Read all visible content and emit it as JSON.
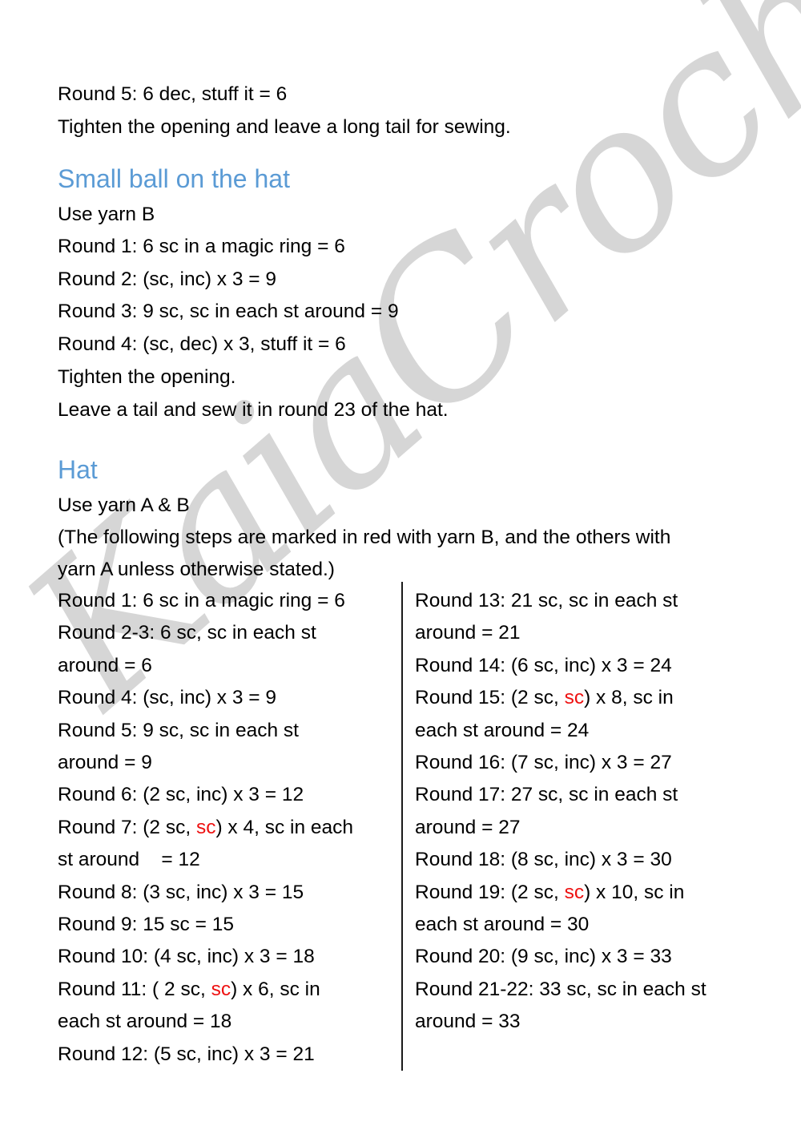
{
  "document": {
    "type": "crochet-pattern",
    "watermark_text": "KaiaCrochet",
    "colors": {
      "heading": "#5b9bd5",
      "body_text": "#000000",
      "yarn_b_marker": "#ee1111",
      "watermark": "#d6d6d6",
      "page_background": "#ffffff",
      "divider": "#1a1a1a"
    }
  },
  "top_section": {
    "lines": [
      "Round 5: 6 dec, stuff it = 6",
      "Tighten the opening and leave a long tail for sewing."
    ]
  },
  "small_ball_section": {
    "heading": "Small ball on the hat",
    "lines": [
      "Use yarn B",
      "Round 1: 6 sc in a magic ring = 6",
      "Round 2: (sc, inc) x 3 = 9",
      "Round 3: 9 sc, sc in each st around = 9",
      "Round 4: (sc, dec) x 3, stuff it = 6",
      "Tighten the opening.",
      "Leave a tail and sew it in round 23 of the hat."
    ]
  },
  "hat_section": {
    "heading": "Hat",
    "intro_lines": [
      "Use yarn A & B",
      "(The following steps are marked in red with yarn B, and the others with",
      "yarn A unless otherwise stated.)"
    ],
    "left_column": [
      {
        "pre": "Round 1: 6 sc in a magic ring = 6",
        "red": "",
        "post": ""
      },
      {
        "pre": "Round 2-3: 6 sc, sc in each st",
        "red": "",
        "post": ""
      },
      {
        "pre": "around = 6",
        "red": "",
        "post": ""
      },
      {
        "pre": "Round 4: (sc, inc) x 3 = 9",
        "red": "",
        "post": ""
      },
      {
        "pre": "Round 5: 9 sc, sc in each st",
        "red": "",
        "post": ""
      },
      {
        "pre": "around = 9",
        "red": "",
        "post": ""
      },
      {
        "pre": "Round 6: (2 sc, inc) x 3 = 12",
        "red": "",
        "post": ""
      },
      {
        "pre": "Round 7: (2 sc, ",
        "red": "sc",
        "post": ") x 4, sc in each"
      },
      {
        "pre": "st around    = 12",
        "red": "",
        "post": ""
      },
      {
        "pre": "Round 8: (3 sc, inc) x 3 = 15",
        "red": "",
        "post": ""
      },
      {
        "pre": "Round 9: 15 sc = 15",
        "red": "",
        "post": ""
      },
      {
        "pre": "Round 10: (4 sc, inc) x 3 = 18",
        "red": "",
        "post": ""
      },
      {
        "pre": "Round 11: ( 2 sc, ",
        "red": "sc",
        "post": ") x 6, sc in"
      },
      {
        "pre": "each st around = 18",
        "red": "",
        "post": ""
      },
      {
        "pre": "Round 12: (5 sc, inc) x 3 = 21",
        "red": "",
        "post": ""
      }
    ],
    "right_column": [
      {
        "pre": "Round 13: 21 sc, sc in each st",
        "red": "",
        "post": ""
      },
      {
        "pre": "around = 21",
        "red": "",
        "post": ""
      },
      {
        "pre": "Round 14: (6 sc, inc) x 3 = 24",
        "red": "",
        "post": ""
      },
      {
        "pre": "Round 15: (2 sc, ",
        "red": "sc",
        "post": ") x 8, sc in"
      },
      {
        "pre": "each st around = 24",
        "red": "",
        "post": ""
      },
      {
        "pre": "Round 16: (7 sc, inc) x 3 = 27",
        "red": "",
        "post": ""
      },
      {
        "pre": "Round 17: 27 sc, sc in each st",
        "red": "",
        "post": ""
      },
      {
        "pre": "around = 27",
        "red": "",
        "post": ""
      },
      {
        "pre": "Round 18: (8 sc, inc) x 3 = 30",
        "red": "",
        "post": ""
      },
      {
        "pre": "Round 19: (2 sc, ",
        "red": "sc",
        "post": ") x 10, sc in"
      },
      {
        "pre": "each st around = 30",
        "red": "",
        "post": ""
      },
      {
        "pre": "Round 20: (9 sc, inc) x 3 = 33",
        "red": "",
        "post": ""
      },
      {
        "pre": "Round 21-22: 33 sc, sc in each st",
        "red": "",
        "post": ""
      },
      {
        "pre": "around = 33",
        "red": "",
        "post": ""
      }
    ]
  }
}
